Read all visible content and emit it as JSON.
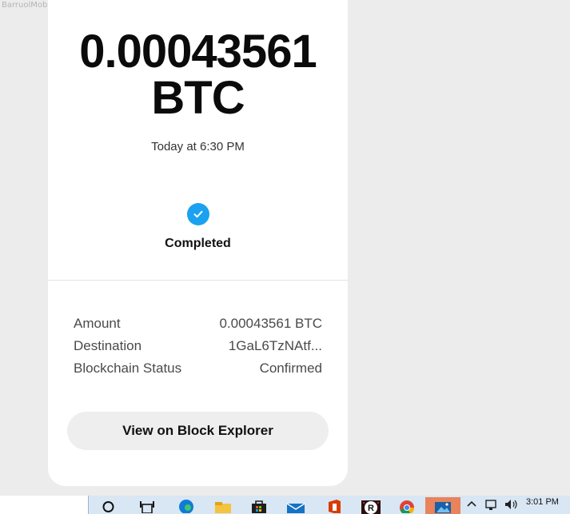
{
  "watermark": "BarruolMob",
  "transaction": {
    "amount_value": "0.00043561",
    "amount_unit": "BTC",
    "timestamp": "Today at 6:30 PM",
    "status": "Completed"
  },
  "details": [
    {
      "label": "Amount",
      "value": "0.00043561 BTC"
    },
    {
      "label": "Destination",
      "value": "1GaL6TzNAtf..."
    },
    {
      "label": "Blockchain Status",
      "value": "Confirmed"
    }
  ],
  "explorer_button": "View on Block Explorer",
  "taskbar": {
    "time": "3:01 PM",
    "apps": [
      "search-icon",
      "task-view-icon",
      "edge-icon",
      "file-explorer-icon",
      "store-icon",
      "mail-icon",
      "office-icon",
      "r-app-icon",
      "chrome-icon",
      "photos-icon"
    ],
    "active_app": "photos-icon",
    "active_color": "#e8835b"
  },
  "colors": {
    "check": "#1aa2f0",
    "card": "#ffffff",
    "background": "#ececec",
    "button": "#eeeeee"
  }
}
